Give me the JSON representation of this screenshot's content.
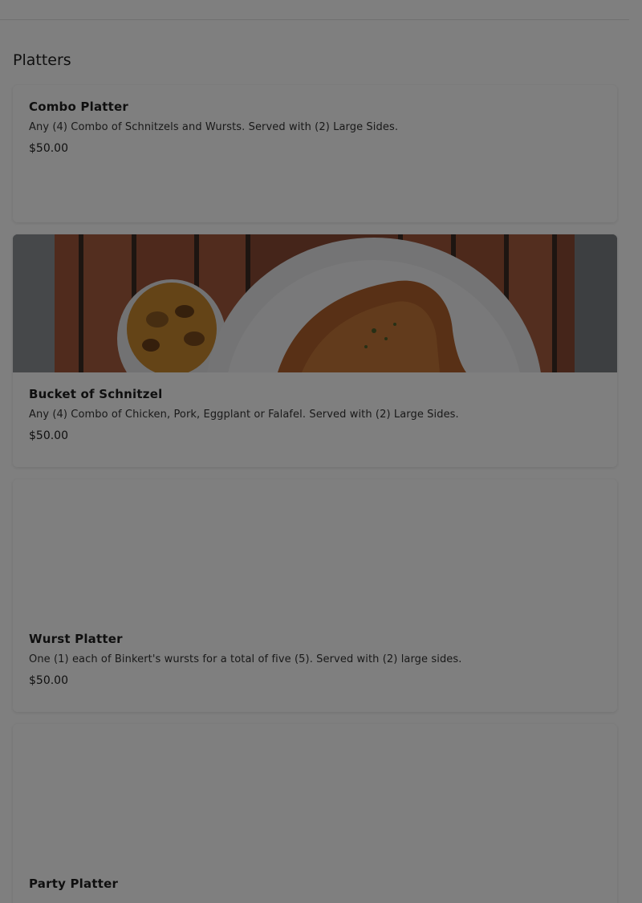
{
  "section": {
    "title": "Platters"
  },
  "items": [
    {
      "name": "Combo Platter",
      "description": "Any (4) Combo of Schnitzels and Wursts. Served with (2) Large Sides.",
      "price": "$50.00"
    },
    {
      "name": "Bucket of Schnitzel",
      "description": "Any (4) Combo of Chicken, Pork, Eggplant or Falafel. Served with (2) Large Sides.",
      "price": "$50.00"
    },
    {
      "name": "Wurst Platter",
      "description": "One (1) each of Binkert's wursts for a total of five (5). Served with (2) large sides.",
      "price": "$50.00"
    },
    {
      "name": "Party Platter",
      "description": "",
      "price": ""
    }
  ],
  "colors": {
    "overlay": "#000000",
    "card": "#ffffff",
    "wood": "#a0543a"
  }
}
